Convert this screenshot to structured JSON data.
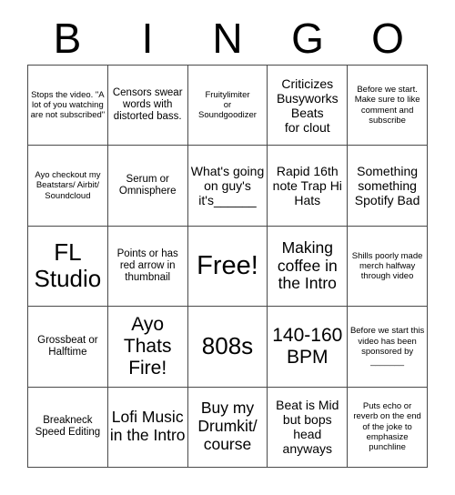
{
  "card": {
    "header_letters": [
      "B",
      "I",
      "N",
      "G",
      "O"
    ],
    "rows": [
      [
        {
          "text": "Stops the video. \"A lot of you watching are not subscribed\"",
          "size": "xs"
        },
        {
          "text": "Censors swear words with distorted bass.",
          "size": "sm"
        },
        {
          "text": "Fruitylimiter\nor\nSoundgoodizer",
          "size": "xs"
        },
        {
          "text": "Criticizes\nBusyworks\nBeats\nfor clout",
          "size": "md"
        },
        {
          "text": "Before we start. Make sure to like comment and subscribe",
          "size": "xs"
        }
      ],
      [
        {
          "text": "Ayo checkout my Beatstars/ Airbit/ Soundcloud",
          "size": "xs"
        },
        {
          "text": "Serum or Omnisphere",
          "size": "sm"
        },
        {
          "text": "What's going on guy's it's______",
          "size": "md"
        },
        {
          "text": "Rapid 16th note Trap Hi Hats",
          "size": "md"
        },
        {
          "text": "Something something Spotify Bad",
          "size": "md"
        }
      ],
      [
        {
          "text": "FL Studio",
          "size": "xxl"
        },
        {
          "text": "Points or has red arrow in thumbnail",
          "size": "sm"
        },
        {
          "text": "Free!",
          "size": "free"
        },
        {
          "text": "Making coffee in the Intro",
          "size": "lg"
        },
        {
          "text": "Shills poorly made merch halfway through video",
          "size": "xs"
        }
      ],
      [
        {
          "text": "Grossbeat or Halftime",
          "size": "sm"
        },
        {
          "text": "Ayo Thats Fire!",
          "size": "xl"
        },
        {
          "text": "808s",
          "size": "xxl"
        },
        {
          "text": "140-160 BPM",
          "size": "xl"
        },
        {
          "text": "Before we start this video has been sponsored by _______",
          "size": "xs"
        }
      ],
      [
        {
          "text": "Breakneck Speed Editing",
          "size": "sm"
        },
        {
          "text": "Lofi Music in the Intro",
          "size": "lg"
        },
        {
          "text": "Buy my Drumkit/ course",
          "size": "lg"
        },
        {
          "text": "Beat is Mid but bops head anyways",
          "size": "md"
        },
        {
          "text": "Puts echo or reverb on the end of the joke to emphasize punchline",
          "size": "xs"
        }
      ]
    ],
    "colors": {
      "border": "#4a4a4a",
      "text": "#000000",
      "background": "#ffffff"
    }
  }
}
